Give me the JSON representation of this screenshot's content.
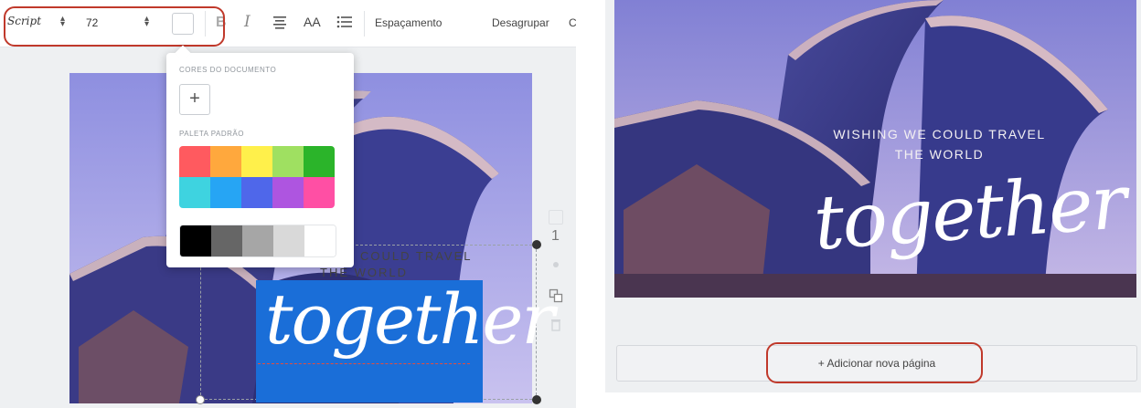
{
  "toolbar": {
    "font_name": "Script",
    "font_size": "72",
    "spacing_label": "Espaçamento",
    "ungroup_label": "Desagrupar",
    "overflow_label": "C",
    "bold_label": "B",
    "italic_label": "I",
    "case_label": "AA"
  },
  "color_popup": {
    "doc_colors_heading": "CORES DO DOCUMENTO",
    "add_color_label": "+",
    "default_palette_heading": "PALETA PADRÃO",
    "palette_rows": [
      [
        "#ff5a5f",
        "#ffa83d",
        "#fff04b",
        "#9fe061",
        "#2bb42a"
      ],
      [
        "#3ed3e0",
        "#26a5f4",
        "#4f67ea",
        "#ae55e0",
        "#ff4fa4"
      ],
      [
        "#000000",
        "#666666",
        "#a6a6a6",
        "#d9d9d9",
        "#ffffff"
      ]
    ]
  },
  "design": {
    "headline_line1": "WISHING WE COULD TRAVEL",
    "headline_line2": "THE WORLD",
    "headline_left_line1": "COULD TRAVEL",
    "headline_left_line2": "THE WORLD",
    "script_word": "together"
  },
  "sidebar": {
    "page_number": "1"
  },
  "right_panel": {
    "add_page_label": "+ Adicionar nova página"
  },
  "colors": {
    "highlight": "#c0392b",
    "selection": "#1a6ed8"
  }
}
